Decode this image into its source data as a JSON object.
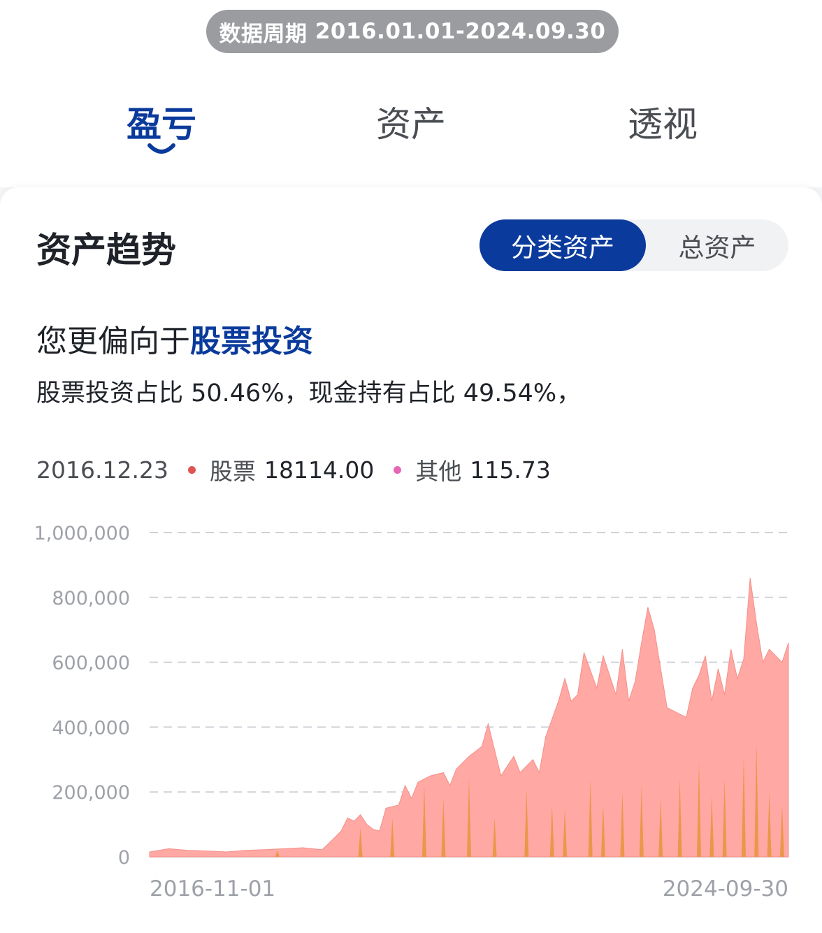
{
  "header": {
    "period_label": "数据周期",
    "period_range": "2016.01.01-2024.09.30"
  },
  "tabs": [
    {
      "label": "盈亏",
      "active": true
    },
    {
      "label": "资产",
      "active": false
    },
    {
      "label": "透视",
      "active": false
    }
  ],
  "card": {
    "title": "资产趋势",
    "segment": {
      "active_label": "分类资产",
      "inactive_label": "总资产"
    },
    "headline_prefix": "您更偏向于",
    "headline_highlight": "股票投资",
    "sentence": "股票投资占比 50.46%，现金持有占比 49.54%，"
  },
  "tooltip": {
    "date": "2016.12.23",
    "items": [
      {
        "name": "股票",
        "value": "18114.00",
        "color": "#e05353"
      },
      {
        "name": "其他",
        "value": "115.73",
        "color": "#e667b4"
      }
    ]
  },
  "colors": {
    "accent": "#0a3a9c",
    "stock_fill": "#ffa8a4",
    "other_fill": "#e8943a",
    "grid": "#cfd2d6"
  },
  "chart_data": {
    "type": "area",
    "ylim": [
      0,
      1000000
    ],
    "yticks": [
      {
        "value": 1000000,
        "label": "1,000,000"
      },
      {
        "value": 800000,
        "label": "800,000"
      },
      {
        "value": 600000,
        "label": "600,000"
      },
      {
        "value": 400000,
        "label": "400,000"
      },
      {
        "value": 200000,
        "label": "200,000"
      },
      {
        "value": 0,
        "label": "0"
      }
    ],
    "xrange": [
      "2016-11-01",
      "2024-09-30"
    ],
    "xticks": [
      "2016-11-01",
      "2024-09-30"
    ],
    "grid": "horizontal-dashed",
    "series": [
      {
        "name": "股票",
        "color": "#ffa8a4",
        "x": [
          0,
          0.03,
          0.06,
          0.09,
          0.12,
          0.15,
          0.18,
          0.21,
          0.24,
          0.27,
          0.29,
          0.3,
          0.31,
          0.32,
          0.33,
          0.34,
          0.35,
          0.36,
          0.37,
          0.39,
          0.4,
          0.41,
          0.42,
          0.43,
          0.44,
          0.46,
          0.47,
          0.48,
          0.5,
          0.52,
          0.53,
          0.55,
          0.57,
          0.58,
          0.6,
          0.61,
          0.62,
          0.64,
          0.65,
          0.66,
          0.67,
          0.68,
          0.7,
          0.71,
          0.72,
          0.73,
          0.74,
          0.75,
          0.76,
          0.77,
          0.78,
          0.79,
          0.8,
          0.81,
          0.82,
          0.83,
          0.84,
          0.85,
          0.86,
          0.87,
          0.88,
          0.89,
          0.9,
          0.91,
          0.92,
          0.93,
          0.94,
          0.95,
          0.96,
          0.97,
          0.98,
          0.99,
          1.0
        ],
        "values": [
          15000,
          25000,
          20000,
          18000,
          15000,
          20000,
          22000,
          25000,
          28000,
          22000,
          60000,
          80000,
          120000,
          110000,
          130000,
          100000,
          85000,
          80000,
          150000,
          160000,
          220000,
          180000,
          230000,
          240000,
          250000,
          260000,
          220000,
          270000,
          310000,
          340000,
          410000,
          250000,
          310000,
          260000,
          300000,
          260000,
          370000,
          480000,
          550000,
          480000,
          500000,
          630000,
          520000,
          620000,
          560000,
          500000,
          640000,
          480000,
          540000,
          660000,
          770000,
          700000,
          580000,
          460000,
          450000,
          440000,
          430000,
          520000,
          560000,
          620000,
          480000,
          580000,
          500000,
          640000,
          550000,
          610000,
          860000,
          720000,
          600000,
          640000,
          620000,
          600000,
          660000
        ]
      },
      {
        "name": "其他",
        "color": "#e8943a",
        "x": [
          0.2,
          0.33,
          0.38,
          0.43,
          0.46,
          0.5,
          0.54,
          0.59,
          0.63,
          0.65,
          0.69,
          0.71,
          0.74,
          0.77,
          0.8,
          0.83,
          0.86,
          0.88,
          0.9,
          0.93,
          0.95,
          0.97,
          0.99
        ],
        "values": [
          20000,
          90000,
          120000,
          220000,
          180000,
          240000,
          120000,
          210000,
          160000,
          150000,
          240000,
          160000,
          200000,
          220000,
          180000,
          240000,
          290000,
          190000,
          240000,
          310000,
          350000,
          200000,
          160000
        ]
      }
    ]
  }
}
